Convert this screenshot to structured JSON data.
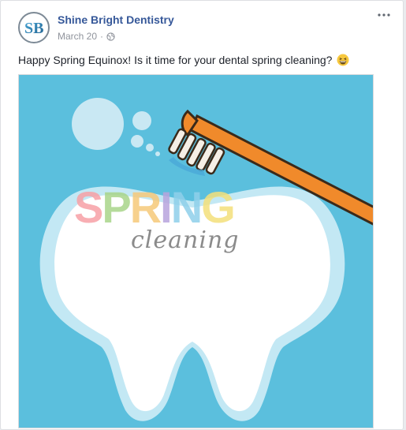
{
  "post": {
    "page_name": "Shine Bright Dentistry",
    "avatar_initials": "SB",
    "date": "March 20",
    "separator": "·",
    "audience_icon": "globe-icon",
    "more_icon": "more-options-icon",
    "text": "Happy Spring Equinox! Is it time for your dental spring cleaning?",
    "emoji": "grinning-squinting-emoji"
  },
  "image": {
    "title_word": "SPRING",
    "subtitle_word": "cleaning",
    "letter_colors": [
      "#f7a1a6",
      "#a9d58a",
      "#f6c97a",
      "#b8a4dd",
      "#8fd0ea",
      "#f4e07b"
    ],
    "background_color": "#5bbfdd",
    "toothbrush_color": "#f08a2b"
  },
  "colors": {
    "link": "#365899",
    "meta": "#90949c",
    "text": "#1d2129"
  }
}
